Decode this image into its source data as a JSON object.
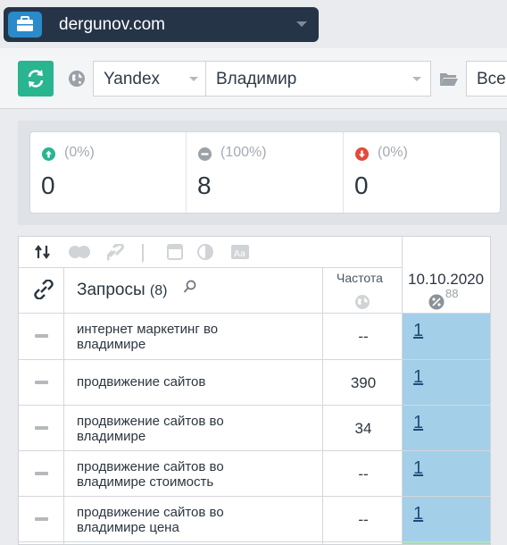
{
  "project": {
    "name": "dergunov.com",
    "icon": "briefcase-icon"
  },
  "toolbar": {
    "search_engine": "Yandex",
    "region": "Владимир",
    "group_filter": "Все"
  },
  "stats": [
    {
      "pct": "(0%)",
      "value": "0",
      "icon": "arrow-up-icon",
      "color": "#28b590"
    },
    {
      "pct": "(100%)",
      "value": "8",
      "icon": "minus-icon",
      "color": "#9aa1a7"
    },
    {
      "pct": "(0%)",
      "value": "0",
      "icon": "arrow-down-icon",
      "color": "#e24a3b"
    }
  ],
  "table": {
    "header": {
      "queries_label": "Запросы",
      "queries_count": "(8)",
      "frequency_label": "Частота",
      "date": "10.10.2020",
      "date_sub": "88"
    },
    "rows": [
      {
        "keyword_line1": "интернет маркетинг во",
        "keyword_line2": "владимире",
        "frequency": "--",
        "position": "1"
      },
      {
        "keyword_line1": "продвижение сайтов",
        "keyword_line2": "",
        "frequency": "390",
        "position": "1"
      },
      {
        "keyword_line1": "продвижение сайтов во",
        "keyword_line2": "владимире",
        "frequency": "34",
        "position": "1"
      },
      {
        "keyword_line1": "продвижение сайтов во",
        "keyword_line2": "владимире стоимость",
        "frequency": "--",
        "position": "1"
      },
      {
        "keyword_line1": "продвижение сайтов во",
        "keyword_line2": "владимире цена",
        "frequency": "--",
        "position": "1"
      }
    ]
  }
}
